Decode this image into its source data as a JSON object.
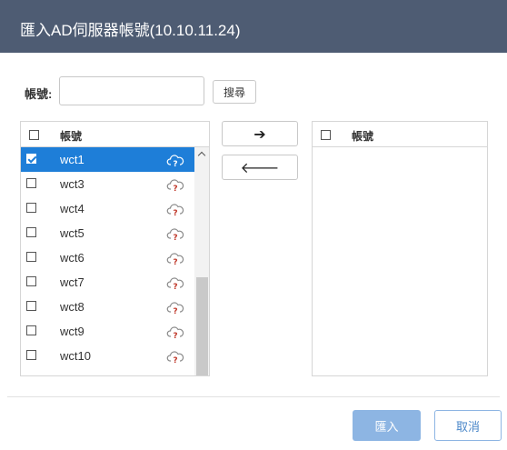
{
  "dialog": {
    "title": "匯入AD伺服器帳號(10.10.11.24)"
  },
  "search": {
    "label": "帳號:",
    "value": "",
    "placeholder": "",
    "button_label": "搜尋"
  },
  "left_list": {
    "header_label": "帳號",
    "rows": [
      {
        "name": "wct1",
        "checked": true,
        "selected": true
      },
      {
        "name": "wct3",
        "checked": false,
        "selected": false
      },
      {
        "name": "wct4",
        "checked": false,
        "selected": false
      },
      {
        "name": "wct5",
        "checked": false,
        "selected": false
      },
      {
        "name": "wct6",
        "checked": false,
        "selected": false
      },
      {
        "name": "wct7",
        "checked": false,
        "selected": false
      },
      {
        "name": "wct8",
        "checked": false,
        "selected": false
      },
      {
        "name": "wct9",
        "checked": false,
        "selected": false
      },
      {
        "name": "wct10",
        "checked": false,
        "selected": false
      }
    ],
    "row_icon": "cloud-unknown-icon"
  },
  "right_list": {
    "header_label": "帳號",
    "rows": []
  },
  "transfer": {
    "move_right_symbol": "➔",
    "move_left_symbol": "🡐",
    "move_right_icon": "arrow-right-icon",
    "move_left_icon": "arrow-left-icon"
  },
  "footer": {
    "import_label": "匯入",
    "cancel_label": "取消"
  },
  "colors": {
    "titlebar": "#4e5c73",
    "selected_row": "#1e7ed8",
    "primary_button": "#8db5e3",
    "cloud_icon": "#c0392b"
  }
}
